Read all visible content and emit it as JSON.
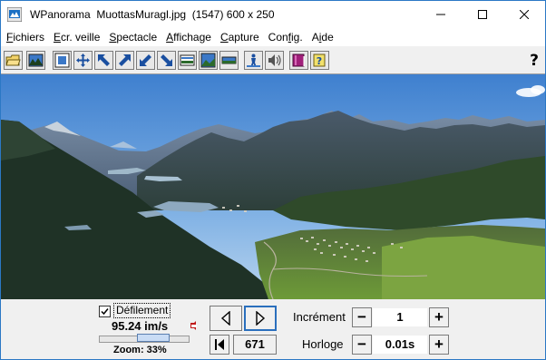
{
  "window": {
    "app_name": "WPanorama",
    "file_name": "MuottasMuragl.jpg",
    "info": "(1547) 600 x 250"
  },
  "menu": [
    {
      "u": "F",
      "rest": "ichiers"
    },
    {
      "u": "E",
      "rest": "cr. veille"
    },
    {
      "u": "S",
      "rest": "pectacle"
    },
    {
      "u": "A",
      "rest": "ffichage"
    },
    {
      "u": "C",
      "rest": "apture"
    },
    {
      "pre": "Con",
      "u": "f",
      "rest": "ig."
    },
    {
      "pre": "A",
      "u": "i",
      "rest": "de"
    }
  ],
  "help_label": "?",
  "controls": {
    "scroll_label": "Défilement",
    "scroll_checked": true,
    "speed": "95.24 im/s",
    "zoom": "Zoom: 33%",
    "zoom_fraction": 0.33,
    "frame": "671",
    "increment_label": "Incrément",
    "increment_value": "1",
    "clock_label": "Horloge",
    "clock_value": "0.01s",
    "minus": "−",
    "plus": "+"
  }
}
